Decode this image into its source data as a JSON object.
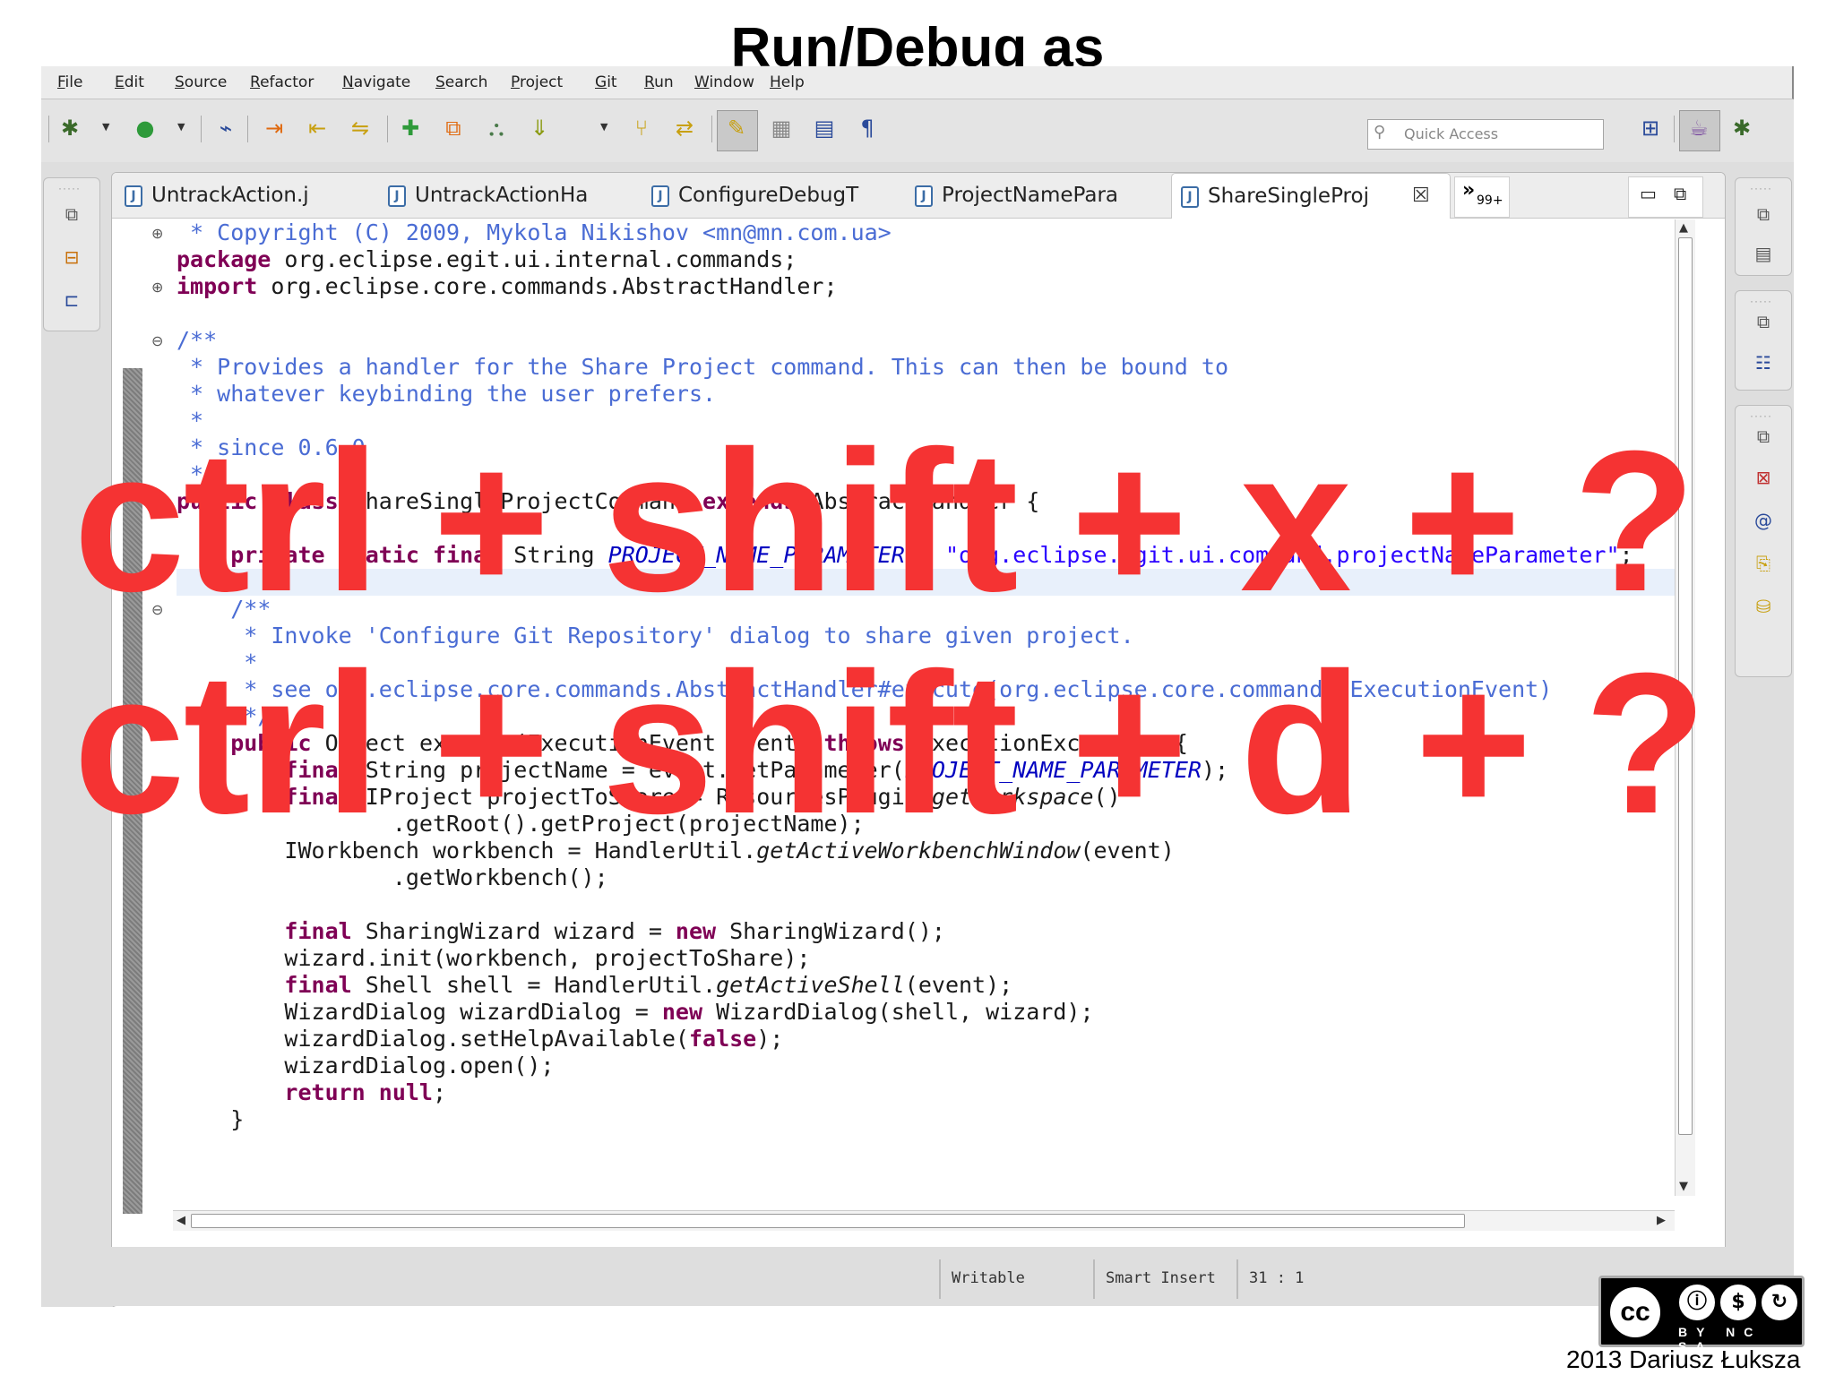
{
  "slide": {
    "title": "Run/Debug as",
    "overlay_lines": [
      "ctrl + shift + x + ?",
      "ctrl + shift + d + ?"
    ],
    "credit": "2013 Dariusz Łuksza",
    "license_badge": {
      "cc": "cc",
      "labels": "BY NC SA"
    }
  },
  "menubar": {
    "items": [
      "File",
      "Edit",
      "Source",
      "Refactor",
      "Navigate",
      "Search",
      "Project",
      "Git",
      "Run",
      "Window",
      "Help"
    ]
  },
  "toolbar": {
    "quick_access_placeholder": "Quick Access"
  },
  "editor": {
    "tabs": [
      {
        "label": "UntrackAction.j"
      },
      {
        "label": "UntrackActionHa"
      },
      {
        "label": "ConfigureDebugT"
      },
      {
        "label": "ProjectNamePara"
      },
      {
        "label": "ShareSingleProj",
        "active": true
      }
    ],
    "overflow": {
      "symbol": "»",
      "count": "99+"
    },
    "code": {
      "l1_comment": " * Copyright (C) 2009, Mykola Nikishov <mn@mn.com.ua>",
      "l2_kw": "package",
      "l2_rest": " org.eclipse.egit.ui.internal.commands;",
      "l3_kw": "import",
      "l3_rest": " org.eclipse.core.commands.AbstractHandler;",
      "l4": "/**",
      "l5": " * Provides a handler for the Share Project command. This can then be bound to",
      "l6": " * whatever keybinding the user prefers.",
      "l7": " *",
      "l8": " * since 0.6.0",
      "l9": " */",
      "l10_kw1": "public",
      "l10_kw2": "class",
      "l10_name": " ShareSingleProjectCommand ",
      "l10_kw3": "extends",
      "l10_rest": " AbstractHandler {",
      "l11_kw": "private static final",
      "l11_type": " String ",
      "l11_field": "PROJECT_NAME_PARAMETER",
      "l11_eq": " = ",
      "l11_str": "\"org.eclipse.egit.ui.command.projectNameParameter\"",
      "l11_end": ";",
      "l12": "/**",
      "l13": " * Invoke 'Configure Git Repository' dialog to share given project.",
      "l14": " *",
      "l15": " * see org.eclipse.core.commands.AbstractHandler#execute(org.eclipse.core.commands.ExecutionEvent)",
      "l16": " */",
      "l17_kw": "public",
      "l17_mid": " Object execute(ExecutionEvent event) ",
      "l17_kw2": "throws",
      "l17_rest": " ExecutionException {",
      "l18_kw": "final",
      "l18_mid": " String projectName = event.getParameter(",
      "l18_field": "PROJECT_NAME_PARAMETER",
      "l18_end": ");",
      "l19_kw": "final",
      "l19_mid": " IProject projectToShare = ResourcesPlugin.",
      "l19_itl": "getWorkspace",
      "l19_end": "()",
      "l20": "        .getRoot().getProject(projectName);",
      "l21_a": "IWorkbench workbench = HandlerUtil.",
      "l21_itl": "getActiveWorkbenchWindow",
      "l21_end": "(event)",
      "l22": "        .getWorkbench();",
      "l23_kw": "final",
      "l23_mid": " SharingWizard wizard = ",
      "l23_kw2": "new",
      "l23_end": " SharingWizard();",
      "l24": "wizard.init(workbench, projectToShare);",
      "l25_kw": "final",
      "l25_mid": " Shell shell = HandlerUtil.",
      "l25_itl": "getActiveShell",
      "l25_end": "(event);",
      "l26_a": "WizardDialog wizardDialog = ",
      "l26_kw": "new",
      "l26_end": " WizardDialog(shell, wizard);",
      "l27_a": "wizardDialog.setHelpAvailable(",
      "l27_kw": "false",
      "l27_end": ");",
      "l28": "wizardDialog.open();",
      "l29_kw": "return null",
      "l29_end": ";",
      "l30": "}"
    }
  },
  "statusbar": {
    "writable": "Writable",
    "insert_mode": "Smart Insert",
    "position": "31 : 1"
  },
  "colors": {
    "overlay_red": "#f53333",
    "keyword": "#7f0055",
    "comment": "#4a6cd4",
    "string": "#2a00ff"
  }
}
